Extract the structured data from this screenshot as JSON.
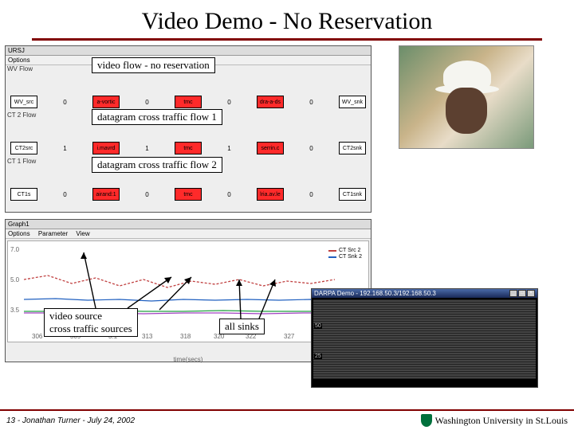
{
  "title": "Video Demo - No Reservation",
  "block_window": {
    "title": "URSJ",
    "menu": "Options",
    "rows": [
      {
        "side": "WV Flow",
        "overlay": "video flow - no reservation",
        "nodes": [
          "WV_src",
          "a-vortic",
          "tmc",
          "dra-a-ds",
          "WV_snk"
        ],
        "edges": [
          "0",
          "0",
          "0",
          "0"
        ]
      },
      {
        "side": "CT 2 Flow",
        "overlay": "datagram cross traffic flow 1",
        "nodes": [
          "CT2src",
          "i.mavrd",
          "tmc",
          "serrin.c",
          "CT2snk"
        ],
        "edges": [
          "1",
          "1",
          "1",
          "0"
        ]
      },
      {
        "side": "CT 1 Flow",
        "overlay": "datagram cross traffic flow 2",
        "nodes": [
          "CT1s",
          "airand:1",
          "tmc",
          "lria.av.le",
          "CT1snk"
        ],
        "edges": [
          "0",
          "0",
          "0",
          "0"
        ]
      }
    ]
  },
  "graph_window": {
    "title": "Graph1",
    "menu": [
      "Options",
      "Parameter",
      "View"
    ],
    "yticks": [
      "7.0",
      "5.0",
      "3.5"
    ],
    "xticks": [
      "306",
      "309",
      "3.1",
      "313",
      "318",
      "320",
      "322",
      "327"
    ],
    "xlabel": "time(secs)",
    "legend": [
      "CT Src 2",
      "CT Snk 2"
    ]
  },
  "labels": {
    "video_source": "video source",
    "cross_sources": "cross traffic sources",
    "all_sinks": "all sinks"
  },
  "darpa_window": {
    "title": "DARPA Demo - 192.168.50.3/192.168.50.3",
    "ylabels": [
      "50",
      "25"
    ]
  },
  "footer_left": "13 - Jonathan Turner - July 24, 2002",
  "footer_right": "Washington University in St.Louis"
}
